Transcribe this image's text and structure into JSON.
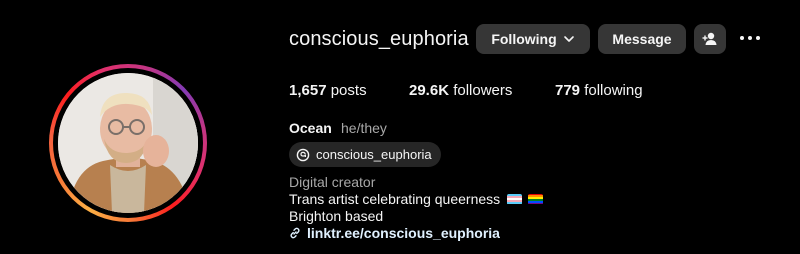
{
  "profile": {
    "username": "conscious_euphoria",
    "following_label": "Following",
    "message_label": "Message",
    "stats": {
      "posts_count": "1,657",
      "posts_label": "posts",
      "followers_count": "29.6K",
      "followers_label": "followers",
      "following_count": "779",
      "following_label": "following"
    },
    "full_name": "Ocean",
    "pronouns": "he/they",
    "threads_handle": "conscious_euphoria",
    "category": "Digital creator",
    "bio_line1": "Trans artist celebrating queerness",
    "bio_line2": "Brighton based",
    "link": "linktr.ee/conscious_euphoria"
  },
  "icons": {
    "following_chevron": "chevron-down-icon",
    "add_user": "add-user-icon",
    "more": "more-dots-icon",
    "threads": "threads-icon",
    "link": "link-icon",
    "trans_flag": "trans-flag-emoji",
    "rainbow_flag": "rainbow-flag-emoji"
  },
  "colors": {
    "background": "#000000",
    "button": "#363636",
    "secondary_text": "#a8a8a8",
    "link_text": "#e0f1ff"
  }
}
